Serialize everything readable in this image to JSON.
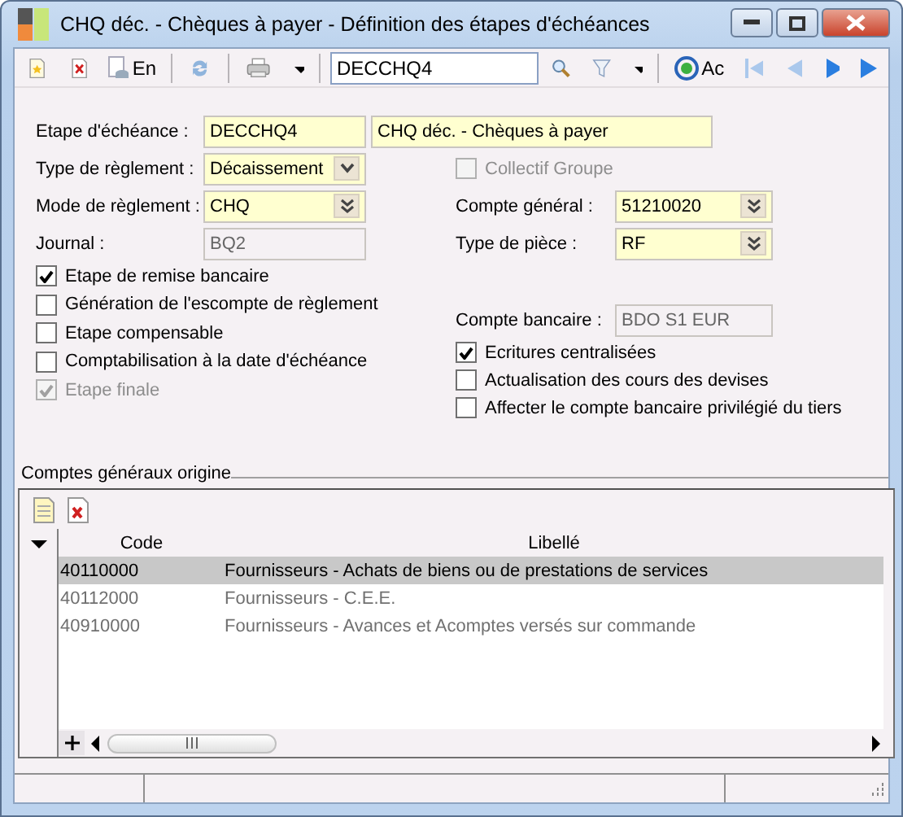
{
  "window": {
    "title": "CHQ déc. - Chèques à payer -  Définition des étapes d'échéances"
  },
  "toolbar": {
    "list_label": "En",
    "search": {
      "value": "DECCHQ4"
    },
    "refresh_label": "Ac"
  },
  "form": {
    "code": {
      "label": "Etape d'échéance :",
      "value": "DECCHQ4",
      "description": "CHQ déc. - Chèques à payer"
    },
    "left_fields": [
      {
        "kind": "combo",
        "label": "Type de règlement :",
        "value": "Décaissement"
      },
      {
        "kind": "lookup",
        "label": "Mode de règlement :",
        "value": "CHQ"
      },
      {
        "kind": "readonly",
        "label": "Journal :",
        "value": "BQ2"
      }
    ],
    "left_checks": [
      {
        "label": "Etape de remise bancaire",
        "checked": true,
        "disabled": false
      },
      {
        "label": "Génération de l'escompte de règlement",
        "checked": false,
        "disabled": false
      },
      {
        "label": "Etape compensable",
        "checked": false,
        "disabled": false
      },
      {
        "label": "Comptabilisation à la date d'échéance",
        "checked": false,
        "disabled": false
      },
      {
        "label": "Etape finale",
        "checked": true,
        "disabled": true
      }
    ],
    "right_items": [
      {
        "kind": "check",
        "label": "Collectif Groupe",
        "checked": false,
        "disabled": true
      },
      {
        "kind": "lookup",
        "label": "Compte général :",
        "value": "51210020"
      },
      {
        "kind": "lookup",
        "label": "Type de pièce :",
        "value": "RF"
      },
      {
        "kind": "readonly",
        "label": "Compte bancaire :",
        "value": "BDO S1 EUR"
      },
      {
        "kind": "check",
        "label": "Ecritures centralisées",
        "checked": true,
        "disabled": false
      },
      {
        "kind": "check",
        "label": "Actualisation des cours des devises",
        "checked": false,
        "disabled": false
      },
      {
        "kind": "check",
        "label": "Affecter le compte bancaire privilégié du tiers",
        "checked": false,
        "disabled": false
      }
    ]
  },
  "grid": {
    "title": "Comptes généraux origine",
    "columns": [
      "Code",
      "Libellé"
    ],
    "rows": [
      {
        "cells": [
          "40110000",
          "Fournisseurs - Achats de biens ou de prestations de services"
        ],
        "selected": true
      },
      {
        "cells": [
          "40112000",
          "Fournisseurs - C.E.E."
        ],
        "selected": false
      },
      {
        "cells": [
          "40910000",
          "Fournisseurs - Avances et Acomptes versés sur commande"
        ],
        "selected": false
      }
    ]
  }
}
